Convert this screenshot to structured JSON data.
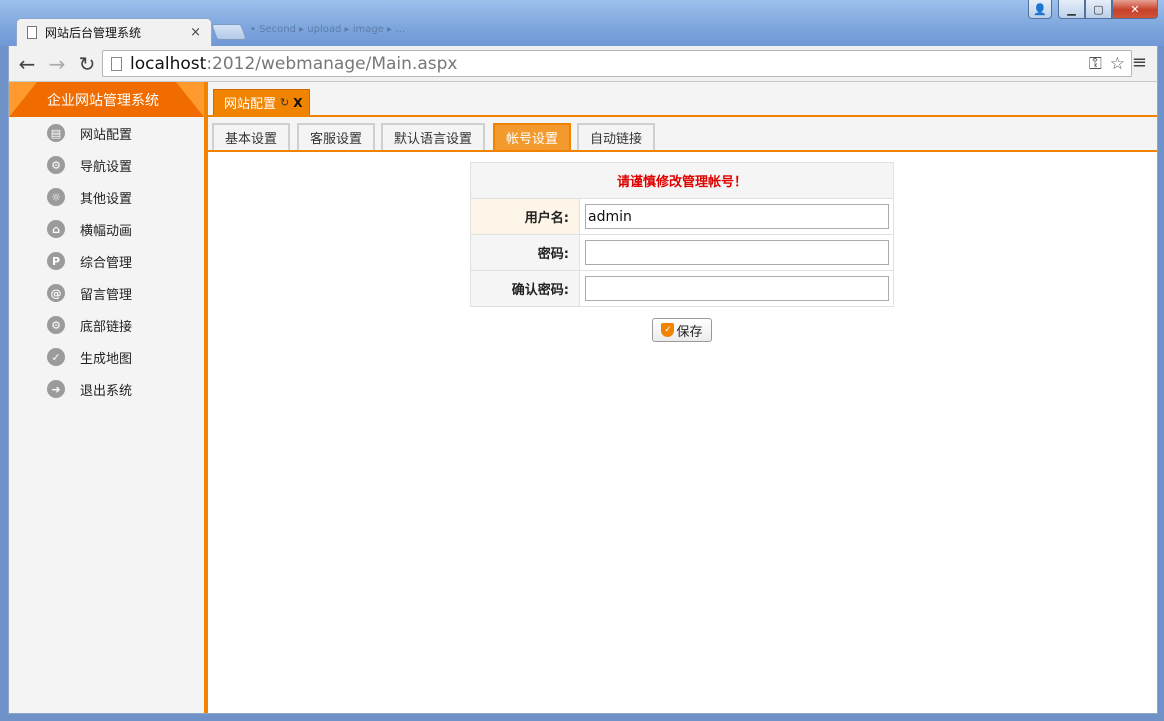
{
  "browser": {
    "tab_title": "网站后台管理系统",
    "tab_close": "×",
    "url_host": "localhost",
    "url_path": ":2012/webmanage/Main.aspx",
    "ghost_tabs": "• Second ▸ upload ▸ image ▸ …"
  },
  "app": {
    "system_title": "企业网站管理系统",
    "sidebar": {
      "items": [
        {
          "label": "网站配置",
          "icon": "monitor-icon",
          "glyph": "▤"
        },
        {
          "label": "导航设置",
          "icon": "wrench-icon",
          "glyph": "⚙"
        },
        {
          "label": "其他设置",
          "icon": "gear-icon",
          "glyph": "☼"
        },
        {
          "label": "横幅动画",
          "icon": "home-icon",
          "glyph": "⌂"
        },
        {
          "label": "综合管理",
          "icon": "parking-icon",
          "glyph": "P"
        },
        {
          "label": "留言管理",
          "icon": "at-icon",
          "glyph": "@"
        },
        {
          "label": "底部链接",
          "icon": "link-icon",
          "glyph": "⚙"
        },
        {
          "label": "生成地图",
          "icon": "check-icon",
          "glyph": "✓"
        },
        {
          "label": "退出系统",
          "icon": "arrow-right-icon",
          "glyph": "➜"
        }
      ]
    },
    "page_tab": {
      "label": "网站配置",
      "close": "X"
    },
    "subtabs": [
      "基本设置",
      "客服设置",
      "默认语言设置",
      "帐号设置",
      "自动链接"
    ],
    "active_subtab": "帐号设置",
    "form": {
      "warning": "请谨慎修改管理帐号！",
      "username_label": "用户名:",
      "username_value": "admin",
      "password_label": "密码:",
      "password_value": "",
      "confirm_label": "确认密码:",
      "confirm_value": "",
      "save_label": "保存"
    }
  },
  "colors": {
    "accent": "#f08300",
    "accent_light": "#f39a2e",
    "warning_text": "#e00000",
    "sidebar_bg": "#f4f4f4"
  }
}
